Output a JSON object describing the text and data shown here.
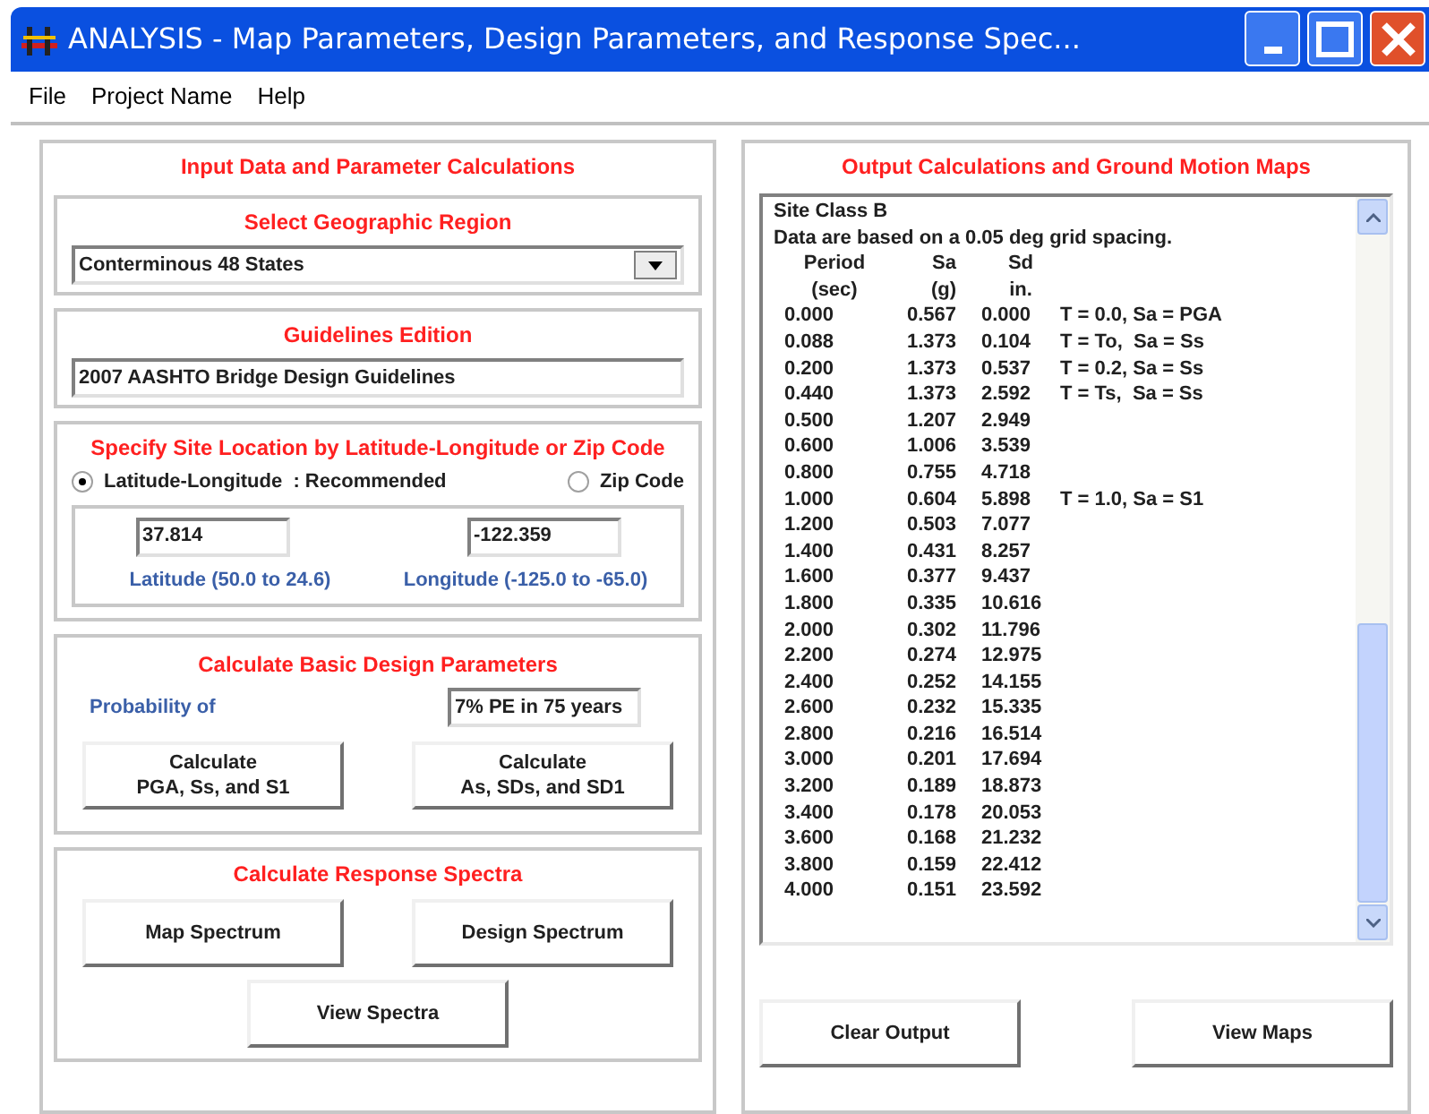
{
  "window": {
    "title": "ANALYSIS - Map Parameters, Design Parameters, and Response Spec..."
  },
  "menu": [
    "File",
    "Project Name",
    "Help"
  ],
  "input_panel": {
    "title": "Input Data and Parameter Calculations",
    "region": {
      "title": "Select Geographic Region",
      "value": "Conterminous 48 States"
    },
    "edition": {
      "title": "Guidelines Edition",
      "value": "2007 AASHTO Bridge Design Guidelines"
    },
    "site": {
      "title": "Specify Site Location by Latitude-Longitude or Zip Code",
      "options": [
        {
          "label": "Latitude-Longitude  : Recommended",
          "selected": true
        },
        {
          "label": "Zip Code",
          "selected": false
        }
      ],
      "latitude": {
        "value": "37.814",
        "label": "Latitude (50.0 to 24.6)"
      },
      "longitude": {
        "value": "-122.359",
        "label": "Longitude (-125.0 to -65.0)"
      }
    },
    "basic": {
      "title": "Calculate Basic Design Parameters",
      "probability_label": "Probability of",
      "probability_value": "7% PE in 75 years",
      "buttons": [
        [
          "Calculate",
          "PGA, Ss, and S1"
        ],
        [
          "Calculate",
          "As, SDs, and SD1"
        ]
      ]
    },
    "spectra": {
      "title": "Calculate Response Spectra",
      "buttons": [
        "Map Spectrum",
        "Design Spectrum",
        "View Spectra"
      ]
    }
  },
  "output_panel": {
    "title": "Output Calculations and Ground Motion Maps",
    "lines": [
      "Site Class B",
      "Data are based on a 0.05 deg grid spacing."
    ],
    "headers": [
      [
        "Period",
        "Sa",
        "Sd"
      ],
      [
        "(sec)",
        "(g)",
        "in."
      ]
    ],
    "rows": [
      {
        "period": "0.000",
        "sa": "0.567",
        "sd": "0.000",
        "note": "T = 0.0, Sa = PGA"
      },
      {
        "period": "0.088",
        "sa": "1.373",
        "sd": "0.104",
        "note": "T = To,  Sa = Ss"
      },
      {
        "period": "0.200",
        "sa": "1.373",
        "sd": "0.537",
        "note": "T = 0.2, Sa = Ss"
      },
      {
        "period": "0.440",
        "sa": "1.373",
        "sd": "2.592",
        "note": "T = Ts,  Sa = Ss"
      },
      {
        "period": "0.500",
        "sa": "1.207",
        "sd": "2.949"
      },
      {
        "period": "0.600",
        "sa": "1.006",
        "sd": "3.539"
      },
      {
        "period": "0.800",
        "sa": "0.755",
        "sd": "4.718"
      },
      {
        "period": "1.000",
        "sa": "0.604",
        "sd": "5.898",
        "note": "T = 1.0, Sa = S1"
      },
      {
        "period": "1.200",
        "sa": "0.503",
        "sd": "7.077"
      },
      {
        "period": "1.400",
        "sa": "0.431",
        "sd": "8.257"
      },
      {
        "period": "1.600",
        "sa": "0.377",
        "sd": "9.437"
      },
      {
        "period": "1.800",
        "sa": "0.335",
        "sd": "10.616"
      },
      {
        "period": "2.000",
        "sa": "0.302",
        "sd": "11.796"
      },
      {
        "period": "2.200",
        "sa": "0.274",
        "sd": "12.975"
      },
      {
        "period": "2.400",
        "sa": "0.252",
        "sd": "14.155"
      },
      {
        "period": "2.600",
        "sa": "0.232",
        "sd": "15.335"
      },
      {
        "period": "2.800",
        "sa": "0.216",
        "sd": "16.514"
      },
      {
        "period": "3.000",
        "sa": "0.201",
        "sd": "17.694"
      },
      {
        "period": "3.200",
        "sa": "0.189",
        "sd": "18.873"
      },
      {
        "period": "3.400",
        "sa": "0.178",
        "sd": "20.053"
      },
      {
        "period": "3.600",
        "sa": "0.168",
        "sd": "21.232"
      },
      {
        "period": "3.800",
        "sa": "0.159",
        "sd": "22.412"
      },
      {
        "period": "4.000",
        "sa": "0.151",
        "sd": "23.592"
      }
    ],
    "buttons": [
      "Clear Output",
      "View Maps"
    ]
  }
}
